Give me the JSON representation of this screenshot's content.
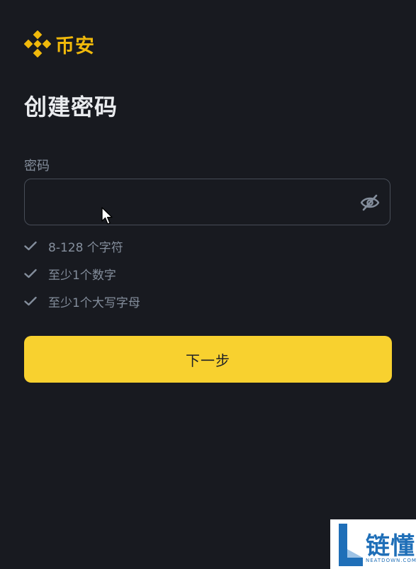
{
  "brand": {
    "name": "币安",
    "color": "#f0b90b"
  },
  "page": {
    "title": "创建密码"
  },
  "password_field": {
    "label": "密码",
    "value": "",
    "toggle_icon": "eye-slash-icon"
  },
  "requirements": [
    {
      "text": "8-128 个字符",
      "icon": "check-icon"
    },
    {
      "text": "至少1个数字",
      "icon": "check-icon"
    },
    {
      "text": "至少1个大写字母",
      "icon": "check-icon"
    }
  ],
  "actions": {
    "next_label": "下一步",
    "button_color": "#f8d12f"
  },
  "watermark": {
    "text": "链懂",
    "subtext": "NEATDOWN.COM"
  }
}
